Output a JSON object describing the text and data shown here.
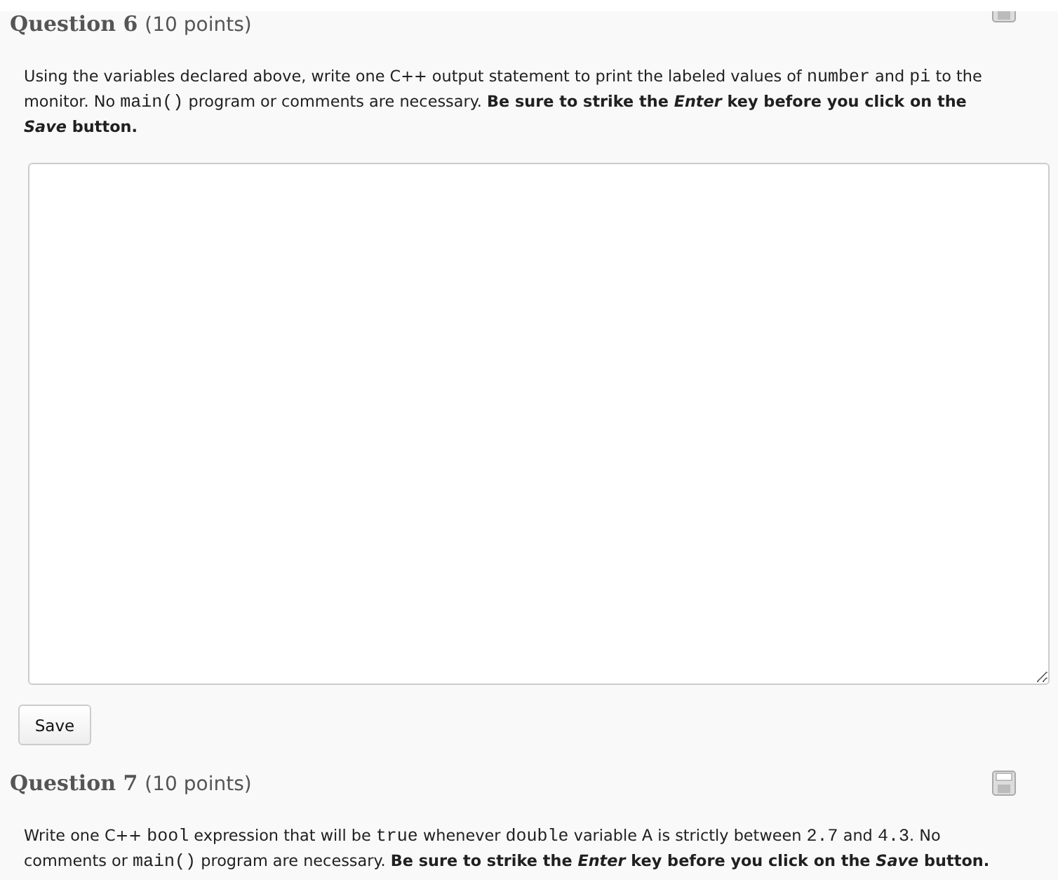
{
  "questions": [
    {
      "title": "Question 6",
      "points": "(10 points)",
      "paragraph": [
        {
          "kind": "text",
          "text": "Using the variables declared above, write one C++ output statement to print the labeled values of "
        },
        {
          "kind": "code",
          "text": "number"
        },
        {
          "kind": "text",
          "text": " and "
        },
        {
          "kind": "code",
          "text": "pi"
        },
        {
          "kind": "text",
          "text": " to the monitor. No "
        },
        {
          "kind": "code",
          "text": "main()"
        },
        {
          "kind": "text",
          "text": " program or comments are necessary. "
        },
        {
          "kind": "bold",
          "text": "Be sure to strike the *Enter* key before you click on the *Save*  button."
        }
      ],
      "save_button": "Save"
    },
    {
      "title": "Question 7",
      "points": "(10 points)",
      "paragraph": [
        {
          "kind": "text",
          "text": "Write one C++ "
        },
        {
          "kind": "code",
          "text": "bool"
        },
        {
          "kind": "text",
          "text": " expression that will be "
        },
        {
          "kind": "code",
          "text": "true"
        },
        {
          "kind": "text",
          "text": " whenever "
        },
        {
          "kind": "code",
          "text": "double"
        },
        {
          "kind": "text",
          "text": " variable "
        },
        {
          "kind": "code",
          "text": "A"
        },
        {
          "kind": "text",
          "text": " is strictly between "
        },
        {
          "kind": "code",
          "text": "2.7"
        },
        {
          "kind": "text",
          "text": " and "
        },
        {
          "kind": "code",
          "text": "4.3"
        },
        {
          "kind": "text",
          "text": ". No comments or "
        },
        {
          "kind": "code",
          "text": "main()"
        },
        {
          "kind": "text",
          "text": " program are necessary. "
        },
        {
          "kind": "bold",
          "text": "Be sure to strike the *Enter* key before you click on the *Save* button."
        }
      ]
    }
  ]
}
